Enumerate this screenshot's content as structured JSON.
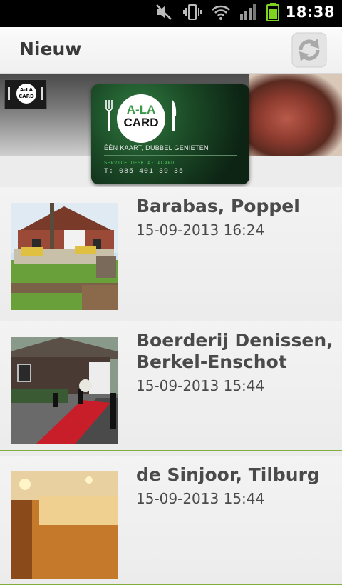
{
  "status_bar": {
    "time": "18:38",
    "icons": [
      "mute-icon",
      "vibrate-icon",
      "wifi-icon",
      "signal-icon",
      "battery-icon"
    ],
    "battery_color": "#7ed321"
  },
  "action_bar": {
    "title": "Nieuw",
    "refresh_icon": "refresh-icon"
  },
  "banner": {
    "small_logo": "A-LA CARD",
    "card": {
      "logo_top": "A-LA",
      "logo_bottom": "CARD",
      "tagline": "ÉÉN KAART, DUBBEL GENIETEN",
      "service": "SERVICE DESK A-LACARD",
      "phone": "T: 085 401 39 35"
    }
  },
  "items": [
    {
      "name": "Barabas, Poppel",
      "date": "15-09-2013 16:24"
    },
    {
      "name": "Boerderij Denissen, Berkel-Enschot",
      "date": "15-09-2013 15:44"
    },
    {
      "name": "de Sinjoor, Tilburg",
      "date": "15-09-2013 15:44"
    }
  ],
  "colors": {
    "accent_green": "#7fae3e",
    "text": "#4a4a4a"
  }
}
